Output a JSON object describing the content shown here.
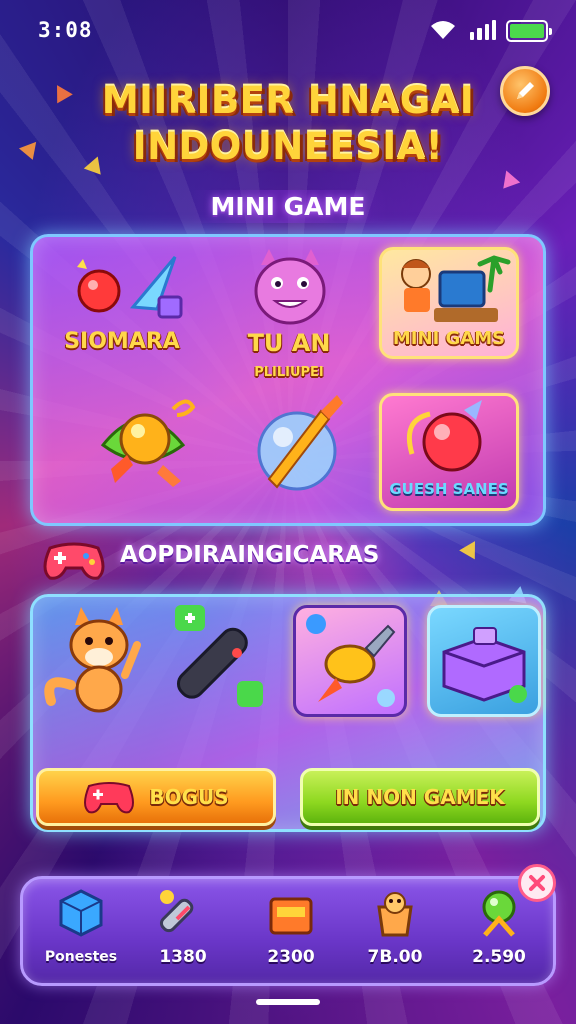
{
  "status_bar": {
    "time": "3:08"
  },
  "header": {
    "title_line1": "MIIRIBER HNAGAI",
    "title_line2": "INDOUNEESIA!"
  },
  "mini_game": {
    "heading": "MINI GAME",
    "tiles": [
      {
        "label": "SIOMARA"
      },
      {
        "label": "TU AN",
        "sublabel": "PLILIUPEI"
      },
      {
        "label": "MINI GAMS"
      },
      {
        "label": ""
      },
      {
        "label": ""
      },
      {
        "label": "GUESH SANES"
      }
    ]
  },
  "secondary": {
    "heading": "AOPDIRAINGICARAS",
    "bonus_label": "BOGUS",
    "win_label": "IN NON GAMEK"
  },
  "bottom_bar": {
    "items": [
      {
        "value": "Ponestes",
        "icon": "cube-icon"
      },
      {
        "value": "1380",
        "icon": "cylinder-icon"
      },
      {
        "value": "2300",
        "icon": "chest-icon"
      },
      {
        "value": "7B.00",
        "icon": "basket-icon"
      },
      {
        "value": "2.590",
        "icon": "orb-icon"
      }
    ]
  },
  "colors": {
    "title": "#ffd43a",
    "accent_orange": "#f07a10",
    "panel_border": "#7fc8ff",
    "bottom_bar": "#6a36c8"
  }
}
